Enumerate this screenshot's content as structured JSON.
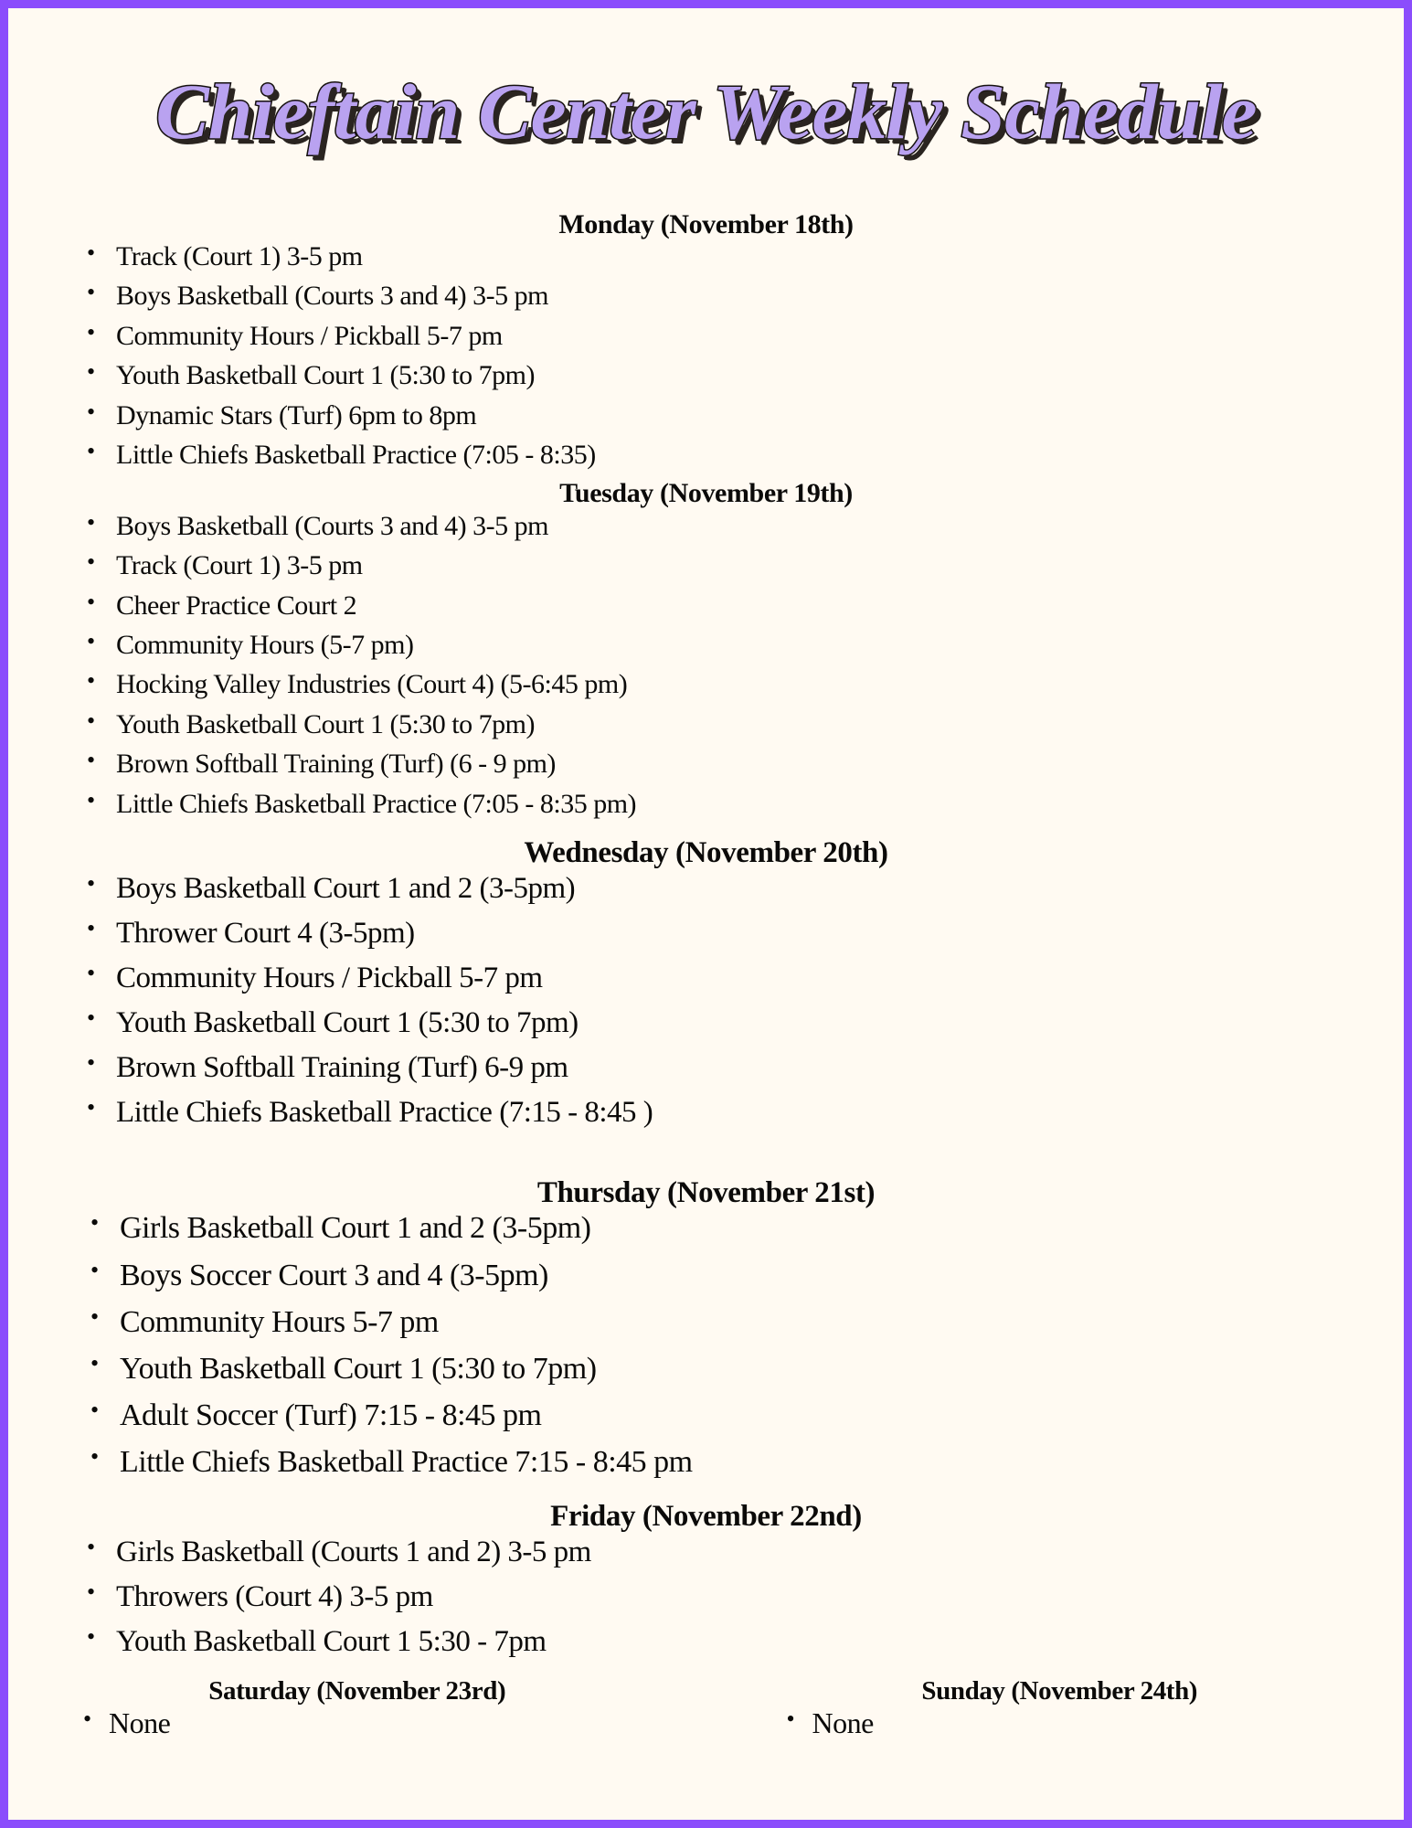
{
  "document": {
    "title": "Chieftain Center Weekly Schedule",
    "border_color": "#8b4dfc",
    "background_color": "#fffaf2",
    "title_color": "#b9a2f0",
    "text_color": "#0b0a09"
  },
  "days": [
    {
      "name": "monday",
      "header": "Monday (November 18th)",
      "items": [
        "Track (Court 1) 3-5 pm",
        "Boys Basketball (Courts 3 and 4) 3-5 pm",
        "Community Hours / Pickball 5-7 pm",
        "Youth Basketball Court 1 (5:30 to 7pm)",
        "Dynamic Stars (Turf) 6pm to 8pm",
        "Little Chiefs Basketball Practice (7:05 - 8:35)"
      ]
    },
    {
      "name": "tuesday",
      "header": "Tuesday (November 19th)",
      "items": [
        "Boys Basketball (Courts 3 and 4) 3-5 pm",
        "Track (Court 1) 3-5 pm",
        "Cheer Practice Court 2",
        "Community Hours (5-7 pm)",
        "Hocking Valley Industries (Court 4) (5-6:45 pm)",
        "Youth Basketball Court 1 (5:30 to 7pm)",
        "Brown Softball Training (Turf) (6 - 9 pm)",
        "Little Chiefs Basketball Practice (7:05 - 8:35 pm)"
      ]
    },
    {
      "name": "wednesday",
      "header": "Wednesday (November 20th)",
      "items": [
        "Boys Basketball Court 1 and 2 (3-5pm)",
        "Thrower Court 4 (3-5pm)",
        "Community Hours / Pickball 5-7 pm",
        "Youth Basketball Court 1 (5:30 to 7pm)",
        "Brown Softball Training (Turf) 6-9 pm",
        "Little Chiefs Basketball Practice (7:15 - 8:45 )"
      ]
    },
    {
      "name": "thursday",
      "header": "Thursday (November 21st)",
      "items": [
        "Girls Basketball Court 1 and 2 (3-5pm)",
        "Boys Soccer Court 3 and 4 (3-5pm)",
        "Community Hours 5-7 pm",
        "Youth Basketball Court 1 (5:30 to 7pm)",
        "Adult Soccer (Turf) 7:15 - 8:45 pm",
        "Little Chiefs Basketball Practice 7:15 - 8:45 pm"
      ]
    },
    {
      "name": "friday",
      "header": "Friday (November 22nd)",
      "items": [
        "Girls Basketball (Courts 1 and 2) 3-5 pm",
        "Throwers (Court 4) 3-5 pm",
        "Youth Basketball Court 1 5:30 - 7pm"
      ]
    },
    {
      "name": "saturday",
      "header": "Saturday (November 23rd)",
      "items": [
        "None"
      ]
    },
    {
      "name": "sunday",
      "header": "Sunday (November 24th)",
      "items": [
        "None"
      ]
    }
  ]
}
